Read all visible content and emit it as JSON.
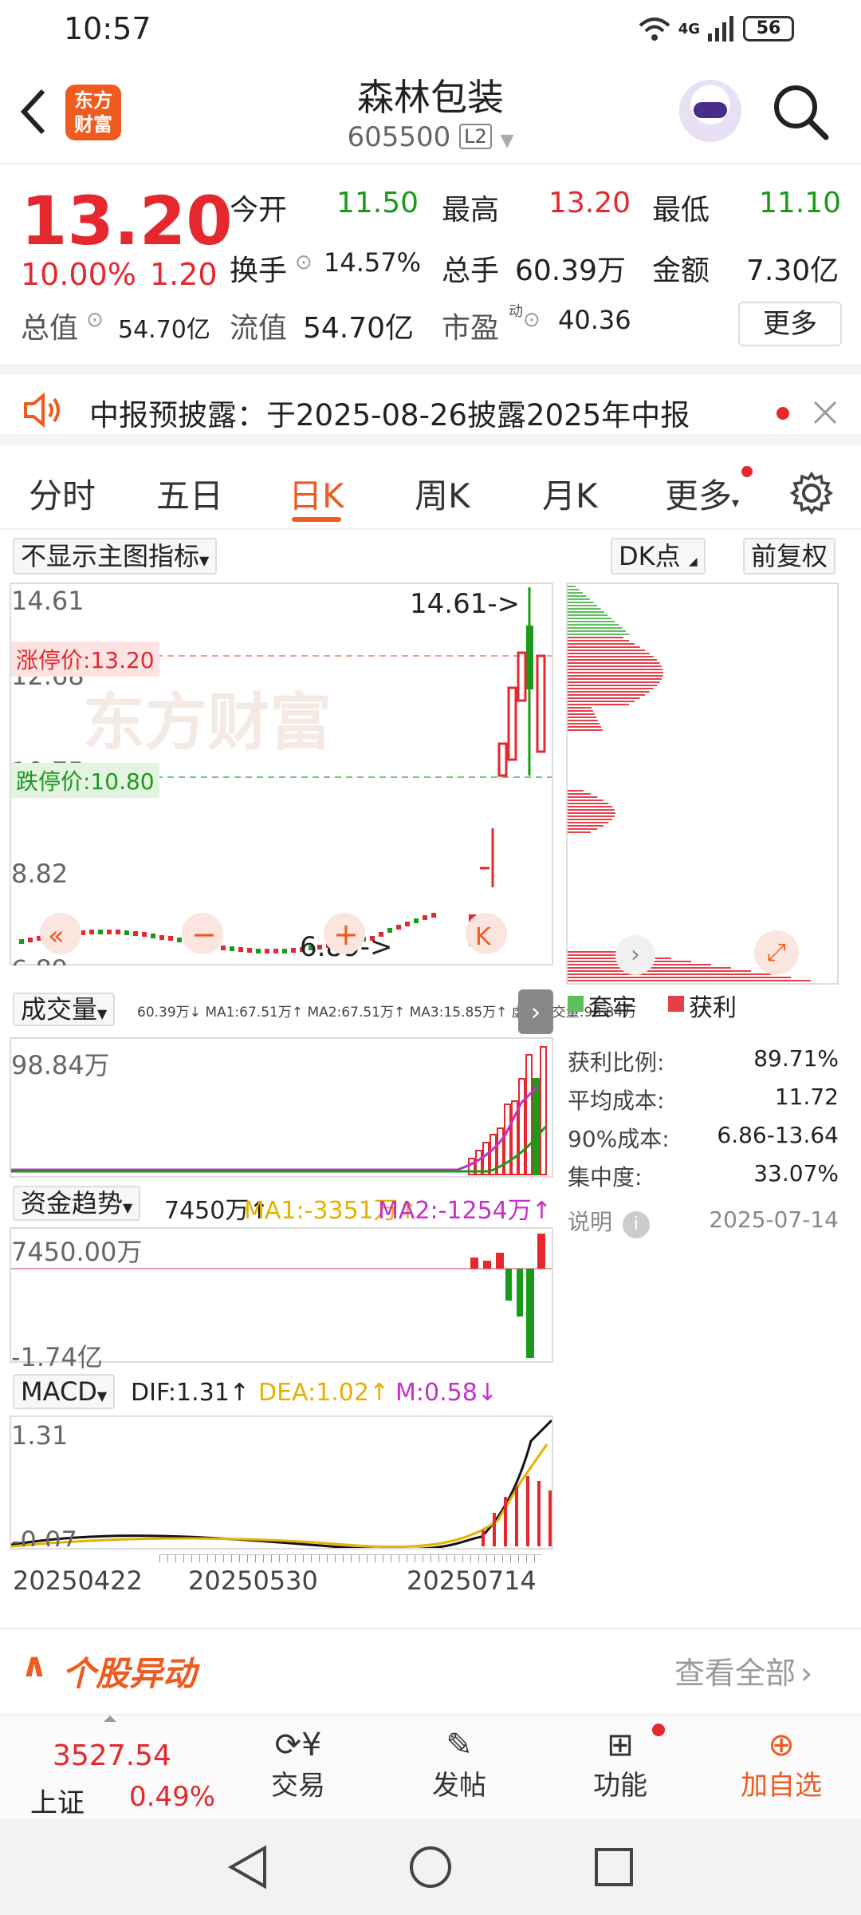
{
  "status": {
    "time": "10:57",
    "net": "4G",
    "battery": "56"
  },
  "header": {
    "logo_line1": "东方",
    "logo_line2": "财富",
    "title": "森林包装",
    "code": "605500",
    "level": "L2"
  },
  "quote": {
    "price": "13.20",
    "pct": "10.00%",
    "change": "1.20",
    "open_label": "今开",
    "open": "11.50",
    "high_label": "最高",
    "high": "13.20",
    "low_label": "最低",
    "low": "11.10",
    "turnover_label": "换手",
    "turnover": "14.57%",
    "volume_label": "总手",
    "volume": "60.39万",
    "amount_label": "金额",
    "amount": "7.30亿",
    "mktcap_label": "总值",
    "mktcap": "54.70亿",
    "float_label": "流值",
    "float": "54.70亿",
    "pe_label": "市盈",
    "pe_sup": "动",
    "pe": "40.36",
    "more": "更多"
  },
  "notice": {
    "text": "中报预披露：于2025-08-26披露2025年中报"
  },
  "tabs": [
    "分时",
    "五日",
    "日K",
    "周K",
    "月K",
    "更多"
  ],
  "chart": {
    "indicator_dd": "不显示主图指标",
    "dk_dd": "DK点",
    "adjust_btn": "前复权",
    "y_labels": [
      "14.61",
      "12.68",
      "10.75",
      "8.82",
      "6.89"
    ],
    "max_label": "14.61->",
    "min_label": "6.89->",
    "limit_up": "涨停价:13.20",
    "limit_down": "跌停价:10.80",
    "watermark": "东方财富",
    "vol_dd": "成交量",
    "vol_legend": "60.39万↓ MA1:67.51万↑ MA2:67.51万↑ MA3:15.85万↑ 虚拟成交量:98.84万",
    "vol_max": "98.84万",
    "fund_dd": "资金趋势",
    "fund_v": "7450万↑",
    "fund_ma1": "MA1:-3351万↑",
    "fund_ma2": "MA2:-1254万↑",
    "fund_top": "7450.00万",
    "fund_bot": "-1.74亿",
    "macd_dd": "MACD",
    "dif": "DIF:1.31↑",
    "dea": "DEA:1.02↑",
    "m": "M:0.58↓",
    "macd_top": "1.31",
    "macd_bot": "-0.07",
    "dates": [
      "20250422",
      "20250530",
      "20250714"
    ]
  },
  "chips": {
    "legend_trap": "套牢",
    "legend_profit": "获利",
    "rows": [
      {
        "label": "获利比例:",
        "value": "89.71%"
      },
      {
        "label": "平均成本:",
        "value": "11.72"
      },
      {
        "label": "90%成本:",
        "value": "6.86-13.64"
      },
      {
        "label": "集中度:",
        "value": "33.07%"
      }
    ],
    "note": "说明",
    "date": "2025-07-14"
  },
  "yidong": {
    "title": "个股异动",
    "link": "查看全部"
  },
  "bottombar": {
    "index_value": "3527.54",
    "index_name": "上证",
    "index_pct": "0.49%",
    "items": [
      "交易",
      "发帖",
      "功能",
      "加自选"
    ]
  }
}
